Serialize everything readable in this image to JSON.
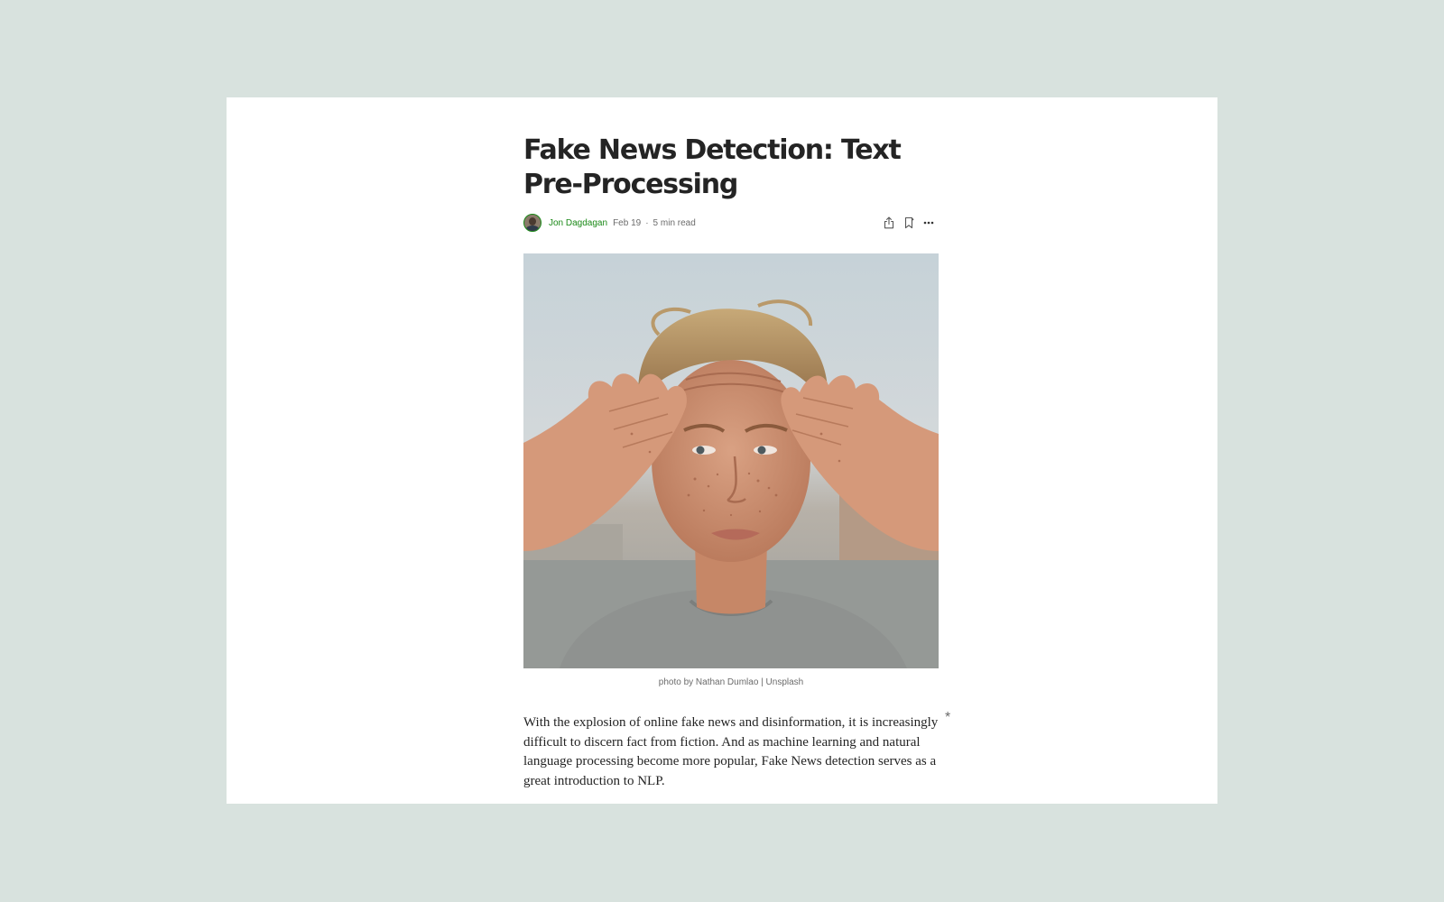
{
  "article": {
    "title": "Fake News Detection: Text Pre-Processing",
    "author": "Jon Dagdagan",
    "date": "Feb 19",
    "separator": "·",
    "read_time": "5 min read",
    "hero_caption": "photo by Nathan Dumlao | Unsplash",
    "paragraph": "With the explosion of online fake news and disinformation, it is increasingly difficult to discern fact from fiction. And as machine learning and natural language processing become more popular, Fake News detection serves as a great introduction to NLP.",
    "highlight_marker": "*"
  },
  "actions": {
    "share_icon": "share-icon",
    "bookmark_icon": "bookmark-icon",
    "more_icon": "more-icon"
  },
  "colors": {
    "background": "#d8e2de",
    "author": "#1a8917",
    "title": "#242424",
    "muted": "#6b6b6b"
  }
}
